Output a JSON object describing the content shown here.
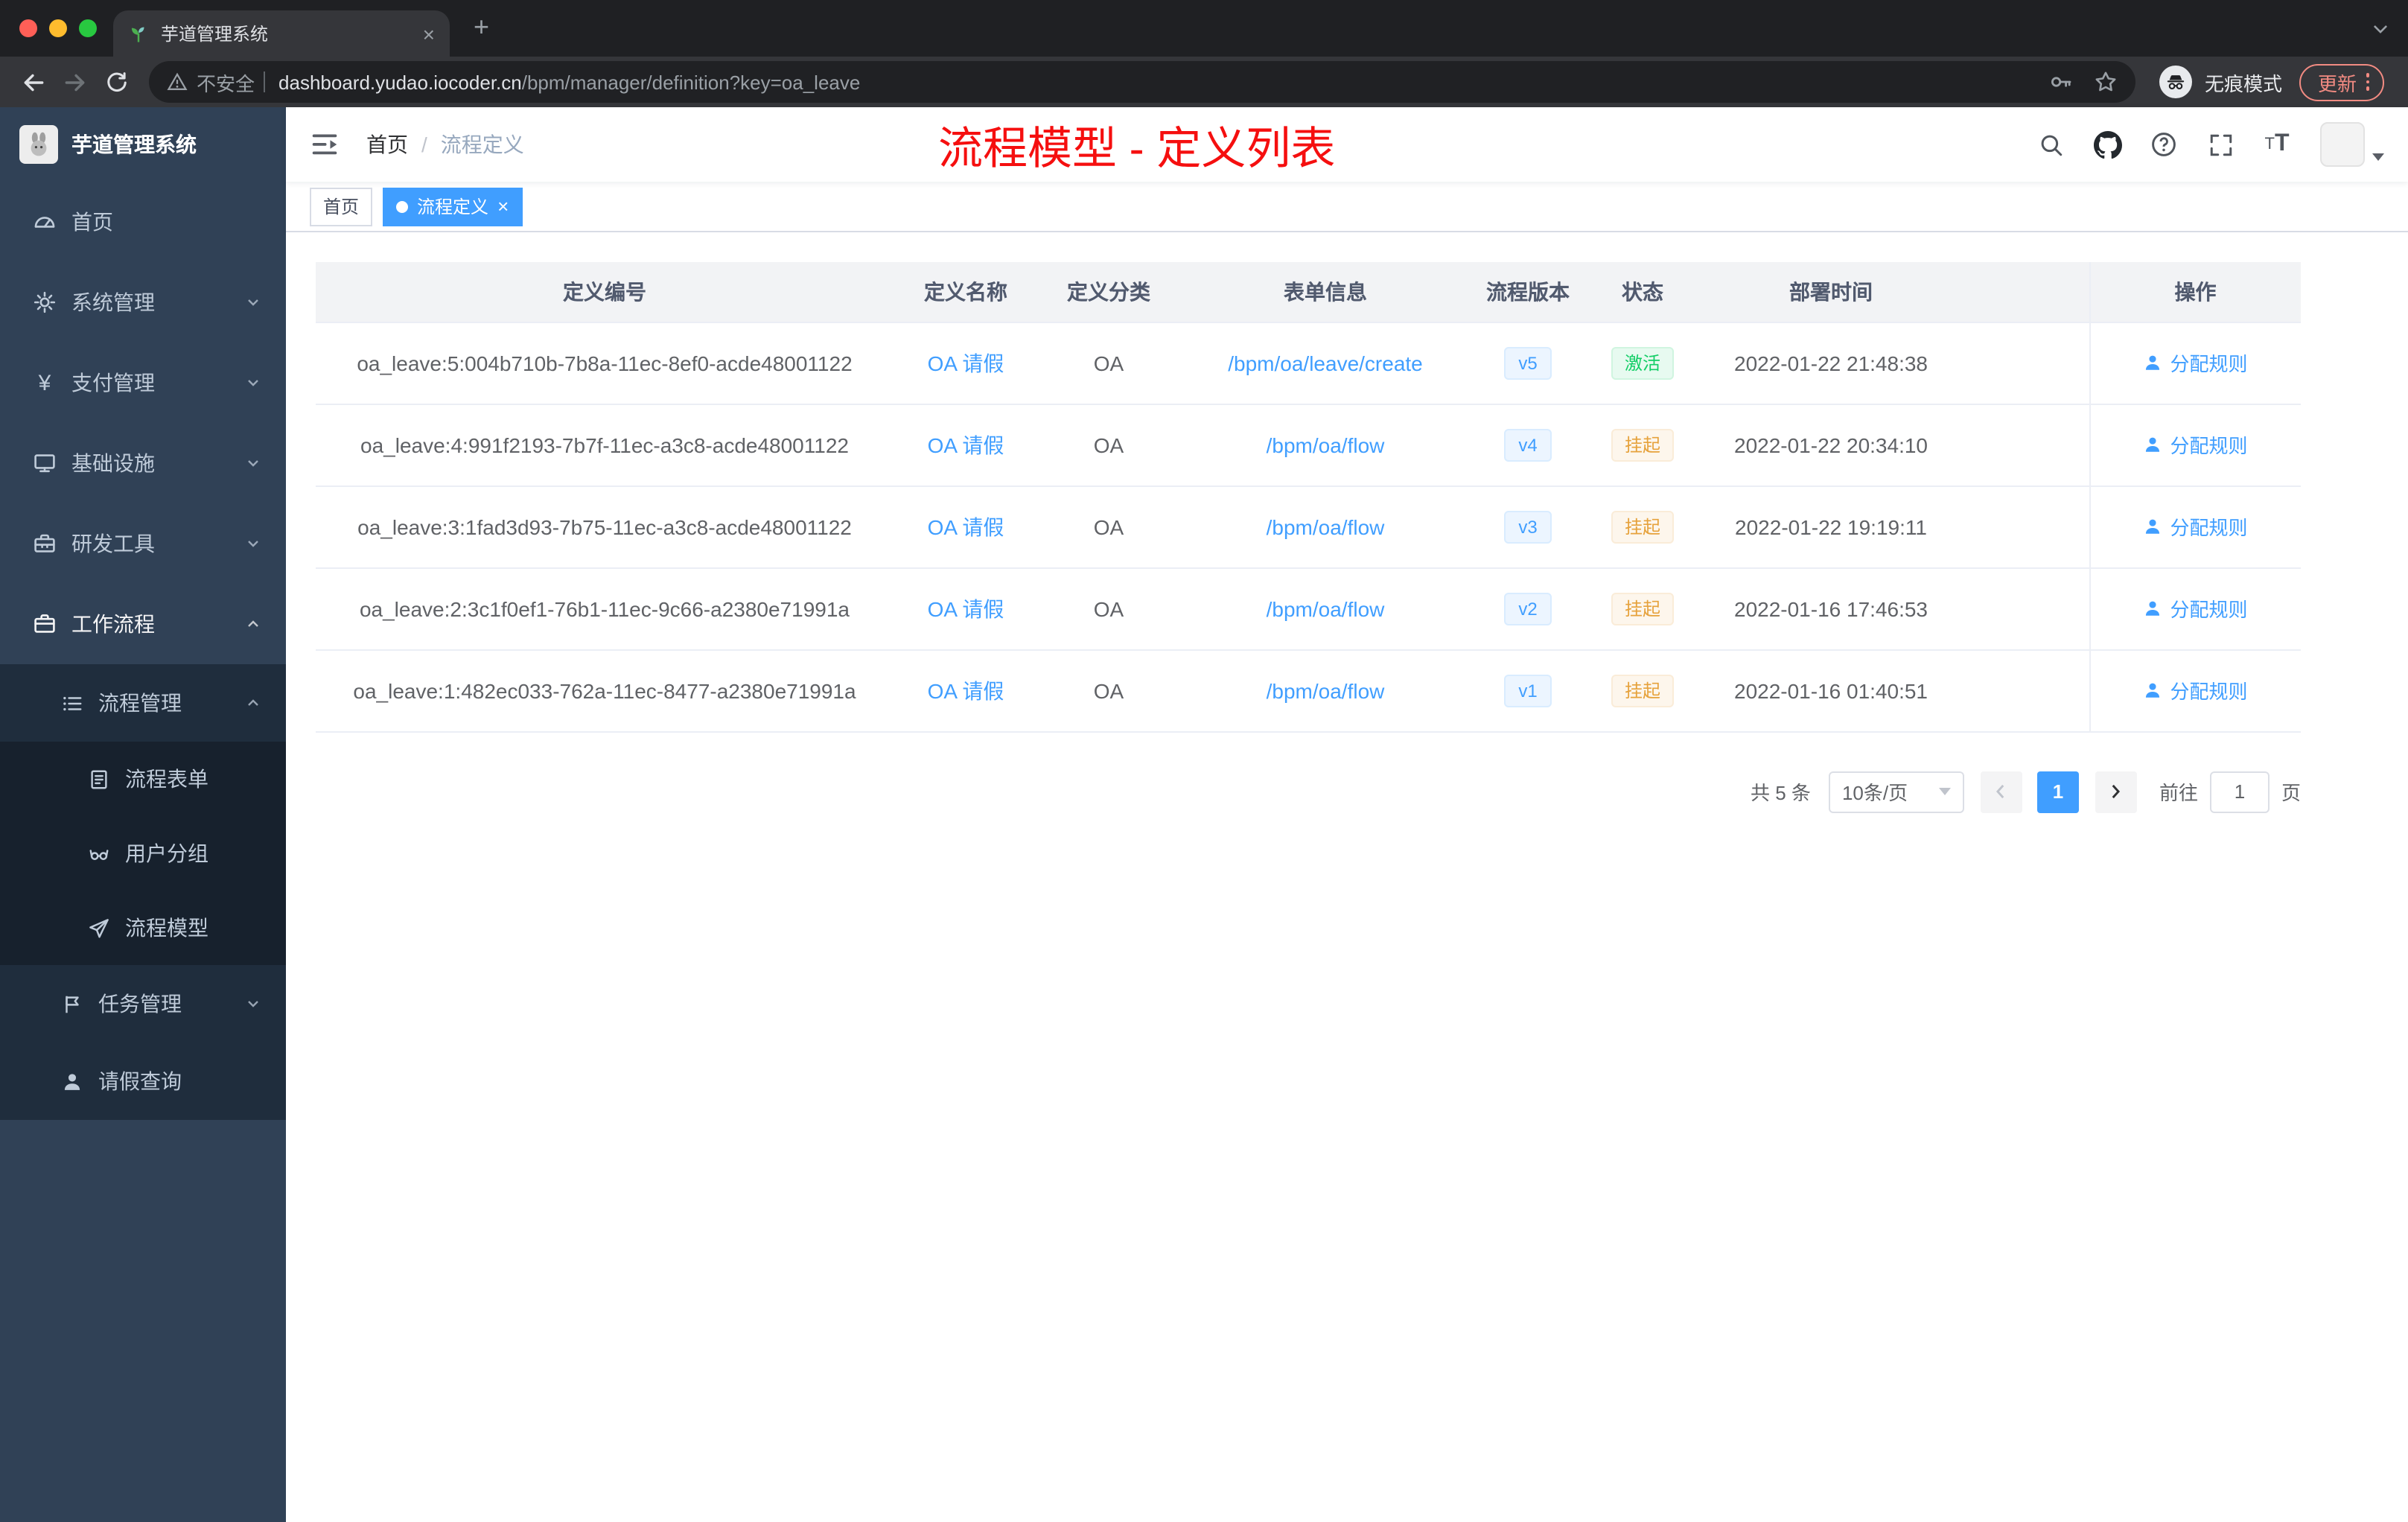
{
  "browser": {
    "tab_title": "芋道管理系统",
    "security_label": "不安全",
    "url_host": "dashboard.yudao.iocoder.cn",
    "url_path": "/bpm/manager/definition?key=oa_leave",
    "incognito_label": "无痕模式",
    "update_label": "更新"
  },
  "glyphs": {
    "close": "×",
    "plus": "+",
    "yen": "¥"
  },
  "sidebar": {
    "logo_title": "芋道管理系统",
    "items": [
      {
        "label": "首页"
      },
      {
        "label": "系统管理"
      },
      {
        "label": "支付管理"
      },
      {
        "label": "基础设施"
      },
      {
        "label": "研发工具"
      },
      {
        "label": "工作流程"
      },
      {
        "label": "流程管理"
      },
      {
        "label": "流程表单"
      },
      {
        "label": "用户分组"
      },
      {
        "label": "流程模型"
      },
      {
        "label": "任务管理"
      },
      {
        "label": "请假查询"
      }
    ]
  },
  "navbar": {
    "breadcrumb_home": "首页",
    "breadcrumb_sep": "/",
    "breadcrumb_current": "流程定义",
    "overlay_title": "流程模型 - 定义列表"
  },
  "tags": {
    "home": "首页",
    "active": "流程定义"
  },
  "table": {
    "columns": [
      "定义编号",
      "定义名称",
      "定义分类",
      "表单信息",
      "流程版本",
      "状态",
      "部署时间",
      "操作"
    ],
    "action_label": "分配规则",
    "rows": [
      {
        "id": "oa_leave:5:004b710b-7b8a-11ec-8ef0-acde48001122",
        "name": "OA 请假",
        "category": "OA",
        "form": "/bpm/oa/leave/create",
        "version": "v5",
        "status": "激活",
        "deployed": "2022-01-22 21:48:38"
      },
      {
        "id": "oa_leave:4:991f2193-7b7f-11ec-a3c8-acde48001122",
        "name": "OA 请假",
        "category": "OA",
        "form": "/bpm/oa/flow",
        "version": "v4",
        "status": "挂起",
        "deployed": "2022-01-22 20:34:10"
      },
      {
        "id": "oa_leave:3:1fad3d93-7b75-11ec-a3c8-acde48001122",
        "name": "OA 请假",
        "category": "OA",
        "form": "/bpm/oa/flow",
        "version": "v3",
        "status": "挂起",
        "deployed": "2022-01-22 19:19:11"
      },
      {
        "id": "oa_leave:2:3c1f0ef1-76b1-11ec-9c66-a2380e71991a",
        "name": "OA 请假",
        "category": "OA",
        "form": "/bpm/oa/flow",
        "version": "v2",
        "status": "挂起",
        "deployed": "2022-01-16 17:46:53"
      },
      {
        "id": "oa_leave:1:482ec033-762a-11ec-8477-a2380e71991a",
        "name": "OA 请假",
        "category": "OA",
        "form": "/bpm/oa/flow",
        "version": "v1",
        "status": "挂起",
        "deployed": "2022-01-16 01:40:51"
      }
    ]
  },
  "pagination": {
    "total": "共 5 条",
    "page_size": "10条/页",
    "current_page": "1",
    "goto": "前往",
    "goto_value": "1",
    "unit": "页"
  },
  "colors": {
    "accent": "#409eff",
    "status_active_green": "#13ce66",
    "status_suspend_orange": "#e6a23c",
    "annotation_red": "#f50f0f",
    "sidebar_bg": "#304156"
  }
}
